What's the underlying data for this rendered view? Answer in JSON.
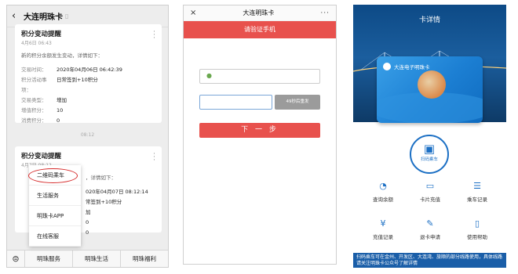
{
  "screen1": {
    "back_icon": "chevron-left-icon",
    "title": "大连明珠卡",
    "card1": {
      "title": "积分变动提醒",
      "date": "4月6日 06:43",
      "desc": "新的积分余额发生变动，详情如下：",
      "rows": [
        {
          "k": "交易时间：",
          "v": "2020年04月06日 06:42:39"
        },
        {
          "k": "积分活动事项：",
          "v": "日常签到+10积分"
        },
        {
          "k": "交易类型：",
          "v": "增加"
        },
        {
          "k": "增值积分：",
          "v": "10"
        },
        {
          "k": "消费积分：",
          "v": "0"
        }
      ]
    },
    "time_separator": "08:12",
    "card2": {
      "title": "积分变动提醒",
      "date": "4月7日 08:12",
      "desc": "，详情如下：",
      "rows": [
        {
          "k": "",
          "v": "020年04月07日 08:12:14"
        },
        {
          "k": "",
          "v": "常签到+10积分"
        },
        {
          "k": "",
          "v": "加"
        },
        {
          "k": "",
          "v": "0"
        },
        {
          "k": "",
          "v": "0"
        }
      ]
    },
    "popup_menu": [
      "二维码乘车",
      "生活服务",
      "明珠卡APP",
      "在线客服"
    ],
    "bottom_menu": [
      "明珠服务",
      "明珠生活",
      "明珠福利"
    ]
  },
  "screen2": {
    "title": "大连明珠卡",
    "close": "×",
    "more": "···",
    "banner": "请验证手机",
    "resend": "49秒后重发",
    "next": "下 一 步"
  },
  "screen3": {
    "title": "卡详情",
    "card_name": "大连电子明珠卡",
    "qr_label": "扫码乘车",
    "grid": [
      {
        "label": "查询余额",
        "icon": "wallet-icon"
      },
      {
        "label": "卡片充值",
        "icon": "card-icon"
      },
      {
        "label": "乘车记录",
        "icon": "list-icon"
      },
      {
        "label": "充值记录",
        "icon": "receipt-icon"
      },
      {
        "label": "退卡申请",
        "icon": "edit-icon"
      },
      {
        "label": "使用帮助",
        "icon": "book-icon"
      }
    ],
    "footer": "扫码乘车可在金州、开发区、大连湾、旅顺的部分线路使用，具体线路请关注明珠卡公众号了解详情"
  },
  "colors": {
    "red": "#e8514d",
    "blue": "#1b6fc4",
    "circle": "#d62b2b"
  }
}
